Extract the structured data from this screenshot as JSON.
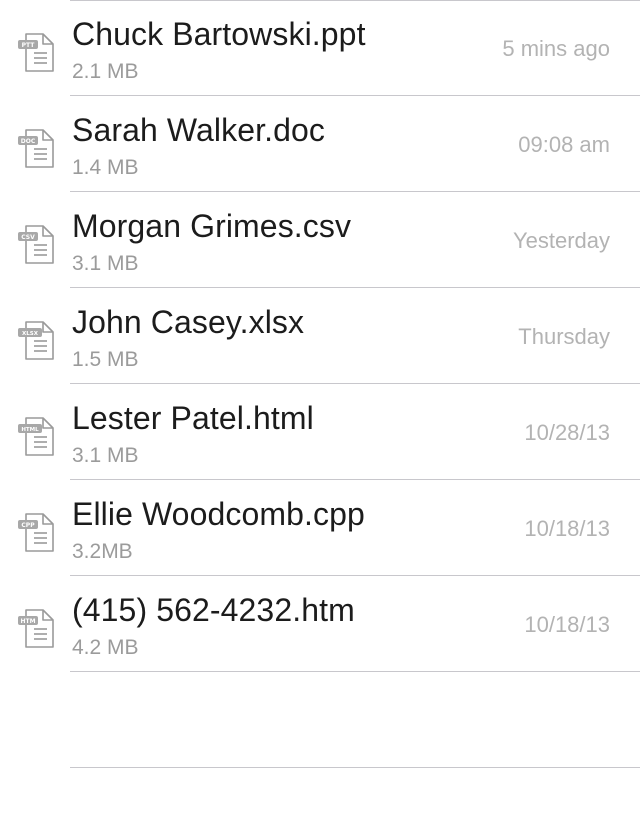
{
  "files": [
    {
      "name": "Chuck Bartowski.ppt",
      "size": "2.1 MB",
      "time": "5 mins ago",
      "badge": "PTT",
      "icon": "document-icon"
    },
    {
      "name": "Sarah Walker.doc",
      "size": "1.4 MB",
      "time": "09:08 am",
      "badge": "DOC",
      "icon": "document-icon"
    },
    {
      "name": "Morgan Grimes.csv",
      "size": "3.1 MB",
      "time": "Yesterday",
      "badge": "CSV",
      "icon": "document-icon"
    },
    {
      "name": "John Casey.xlsx",
      "size": "1.5 MB",
      "time": "Thursday",
      "badge": "XLSX",
      "icon": "document-icon"
    },
    {
      "name": "Lester Patel.html",
      "size": "3.1 MB",
      "time": "10/28/13",
      "badge": "HTML",
      "icon": "document-icon"
    },
    {
      "name": "Ellie Woodcomb.cpp",
      "size": "3.2MB",
      "time": "10/18/13",
      "badge": "CPP",
      "icon": "document-icon"
    },
    {
      "name": "(415) 562-4232.htm",
      "size": "4.2 MB",
      "time": "10/18/13",
      "badge": "HTM",
      "icon": "document-icon"
    }
  ],
  "colors": {
    "separator": "#c8c7cc",
    "name_text": "#1c1c1c",
    "size_text": "#9b9b9b",
    "time_text": "#b3b3b3",
    "icon_stroke": "#9a9a9a",
    "badge_fill": "#a8a8a8"
  }
}
